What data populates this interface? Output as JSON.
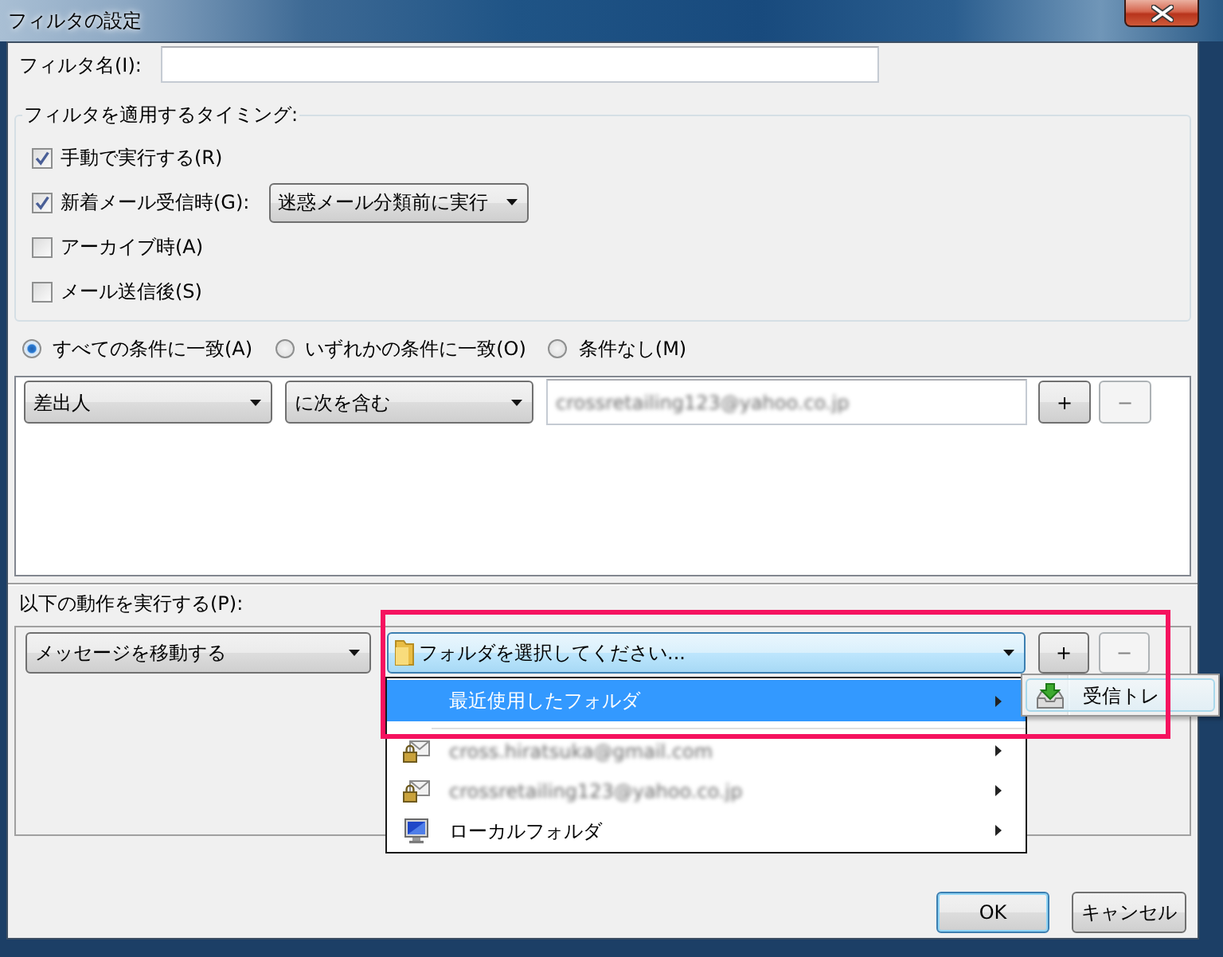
{
  "window": {
    "title": "フィルタの設定"
  },
  "filter_name": {
    "label": "フィルタ名(I):"
  },
  "timing": {
    "title": "フィルタを適用するタイミング:",
    "options": [
      {
        "label": "手動で実行する(R)",
        "checked": true
      },
      {
        "label": "新着メール受信時(G):",
        "checked": true,
        "dropdown": "迷惑メール分類前に実行"
      },
      {
        "label": "アーカイブ時(A)",
        "checked": false
      },
      {
        "label": "メール送信後(S)",
        "checked": false
      }
    ]
  },
  "match_modes": [
    {
      "label": "すべての条件に一致(A)",
      "selected": true
    },
    {
      "label": "いずれかの条件に一致(O)",
      "selected": false
    },
    {
      "label": "条件なし(M)",
      "selected": false
    }
  ],
  "conditions": [
    {
      "field": "差出人",
      "operator": "に次を含む",
      "value": "crossretailing123@yahoo.co.jp",
      "value_blurred": true,
      "add_button": {
        "label": "+",
        "disabled": false
      },
      "remove_button": {
        "label": "−",
        "disabled": true
      }
    }
  ],
  "actions_title": "以下の動作を実行する(P):",
  "actions": [
    {
      "action": "メッセージを移動する",
      "target": {
        "label": "フォルダを選択してください...",
        "expanded": true,
        "menu": [
          {
            "kind": "recent",
            "label": "最近使用したフォルダ",
            "selected": true,
            "blurred": false,
            "children": [
              {
                "label": "受信トレ",
                "selected": true
              }
            ]
          },
          {
            "kind": "separator"
          },
          {
            "kind": "account",
            "label": "cross.hiratsuka@gmail.com",
            "selected": false,
            "blurred": true
          },
          {
            "kind": "account",
            "label": "crossretailing123@yahoo.co.jp",
            "selected": false,
            "blurred": true
          },
          {
            "kind": "local",
            "label": "ローカルフォルダ",
            "selected": false,
            "blurred": false
          }
        ]
      },
      "add_button": {
        "label": "+",
        "disabled": false
      },
      "remove_button": {
        "label": "−",
        "disabled": true
      }
    }
  ],
  "buttons": [
    {
      "label": "OK",
      "kind": "default"
    },
    {
      "label": "キャンセル",
      "kind": "normal"
    }
  ]
}
